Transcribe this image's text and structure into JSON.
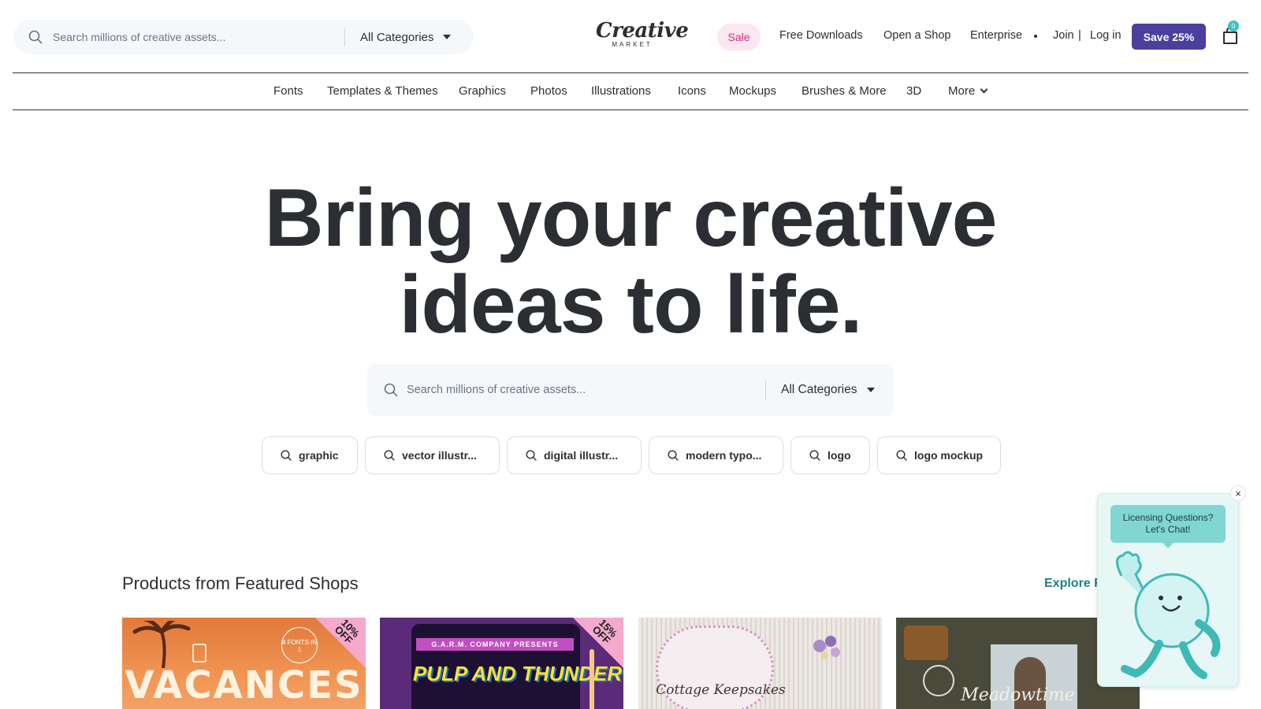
{
  "header": {
    "search_placeholder": "Search millions of creative assets...",
    "category_label": "All Categories",
    "logo_script": "Creative",
    "logo_sub": "MARKET",
    "sale_label": "Sale",
    "nav": [
      "Free Downloads",
      "Open a Shop",
      "Enterprise"
    ],
    "join_label": "Join",
    "separator": "|",
    "login_label": "Log in",
    "save_label": "Save 25%",
    "cart_count": "0"
  },
  "category_nav": [
    "Fonts",
    "Templates & Themes",
    "Graphics",
    "Photos",
    "Illustrations",
    "Icons",
    "Mockups",
    "Brushes & More",
    "3D",
    "More"
  ],
  "hero": {
    "title_line1": "Bring your creative",
    "title_line2": "ideas to life.",
    "search_placeholder": "Search millions of creative assets...",
    "category_label": "All Categories",
    "suggestions": [
      "graphic",
      "vector illustr...",
      "digital illustr...",
      "modern typo...",
      "logo",
      "logo mockup"
    ]
  },
  "featured": {
    "title": "Products from Featured Shops",
    "explore_label": "Explore F",
    "cards": [
      {
        "label": "VACANCES",
        "discount": "10% OFF",
        "note": "4 FONTS IN 1"
      },
      {
        "label": "PULP AND THUNDER",
        "discount": "15% OFF",
        "note": "G.A.R.M. COMPANY PRESENTS"
      },
      {
        "label": "Cottage Keepsakes"
      },
      {
        "label": "Meadowtime"
      }
    ]
  },
  "chat": {
    "line1": "Licensing Questions?",
    "line2": "Let's Chat!",
    "close": "×"
  },
  "colors": {
    "text": "#2b2f33",
    "accent_purple": "#4b3f9e",
    "sale_pink": "#d22f7b",
    "teal": "#3fc2c1",
    "link_teal": "#1f7f86"
  }
}
